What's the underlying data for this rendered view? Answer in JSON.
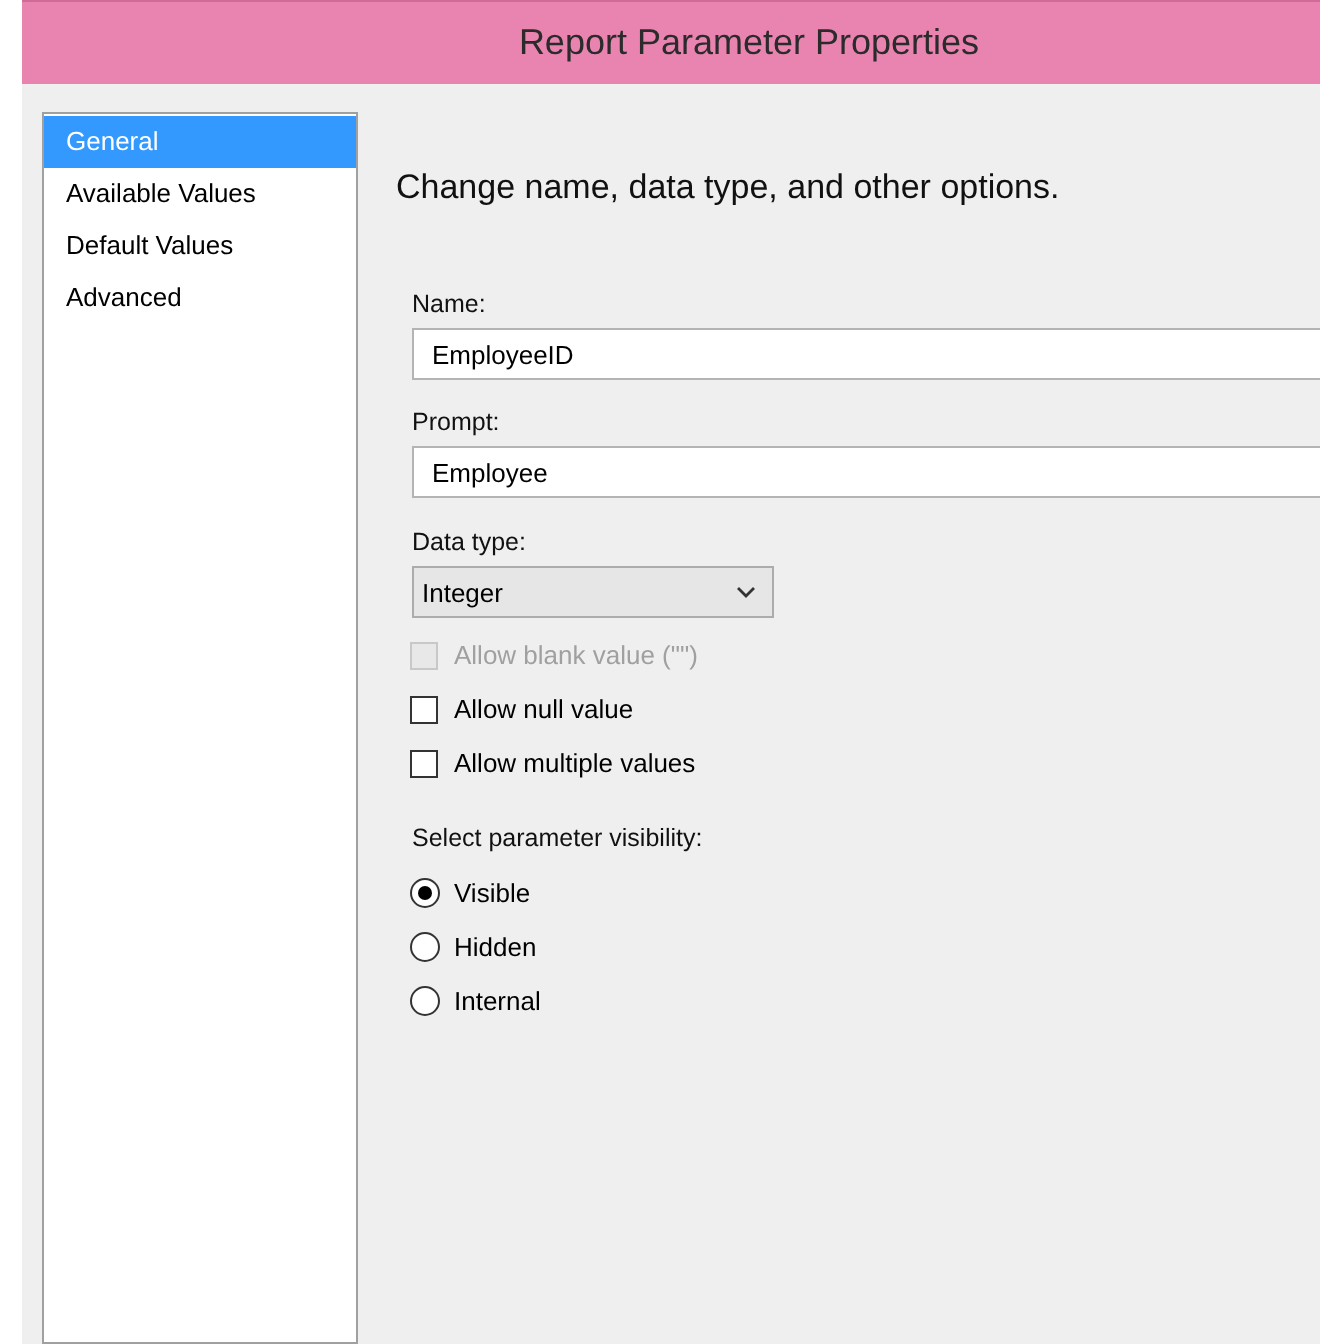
{
  "window": {
    "title": "Report Parameter Properties"
  },
  "sidebar": {
    "items": [
      {
        "label": "General",
        "selected": true
      },
      {
        "label": "Available Values",
        "selected": false
      },
      {
        "label": "Default Values",
        "selected": false
      },
      {
        "label": "Advanced",
        "selected": false
      }
    ]
  },
  "heading": "Change name, data type, and other options.",
  "name_field": {
    "label": "Name:",
    "value": "EmployeeID"
  },
  "prompt_field": {
    "label": "Prompt:",
    "value": "Employee"
  },
  "data_type": {
    "label": "Data type:",
    "value": "Integer"
  },
  "options": [
    {
      "label": "Allow blank value (\"\")",
      "checked": false,
      "disabled": true
    },
    {
      "label": "Allow null value",
      "checked": false,
      "disabled": false
    },
    {
      "label": "Allow multiple values",
      "checked": false,
      "disabled": false
    }
  ],
  "visibility": {
    "label": "Select parameter visibility:",
    "options": [
      {
        "label": "Visible",
        "selected": true
      },
      {
        "label": "Hidden",
        "selected": false
      },
      {
        "label": "Internal",
        "selected": false
      }
    ]
  }
}
